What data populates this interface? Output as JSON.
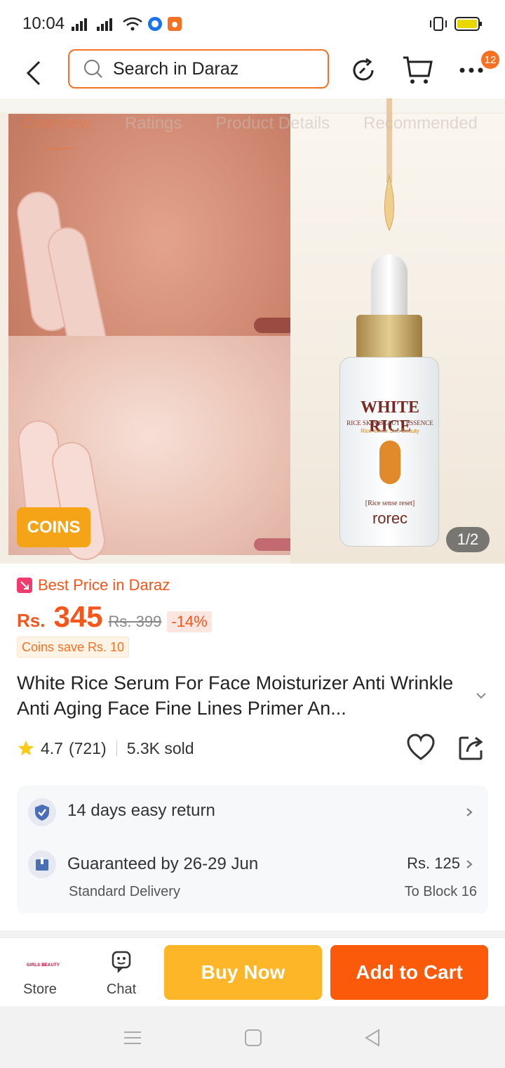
{
  "status_bar": {
    "time": "10:04"
  },
  "header": {
    "search_placeholder": "Search in Daraz",
    "cart_badge": "12"
  },
  "gallery": {
    "tabs": [
      "Overview",
      "Ratings",
      "Product Details",
      "Recommended"
    ],
    "coins_badge": "COINS",
    "page_counter": "1/2",
    "bottle_label": {
      "title": "WHITE RICE",
      "sub": "RICE SKIN BEAUTY ESSENCE",
      "sub2": "Rice White Skin Beauty",
      "small": "[Rice sense reset]",
      "brand": "rorec"
    }
  },
  "product": {
    "best_price": "Best Price in Daraz",
    "currency": "Rs.",
    "price": "345",
    "old_price": "Rs. 399",
    "discount": "-14%",
    "coins_save": "Coins save Rs. 10",
    "title": "White Rice Serum For Face Moisturizer Anti Wrinkle Anti Aging Face Fine Lines Primer An...",
    "rating": "4.7",
    "rating_count": "(721)",
    "sold": "5.3K sold"
  },
  "services": {
    "return_text": "14 days easy return",
    "delivery_text": "Guaranteed by 26-29 Jun",
    "delivery_sub": "Standard Delivery",
    "delivery_price": "Rs. 125",
    "delivery_dest": "To Block 16"
  },
  "bottom_bar": {
    "store_logo": "GIRLS BEAUTY",
    "store_label": "Store",
    "chat_label": "Chat",
    "buy_now": "Buy Now",
    "add_to_cart": "Add to Cart"
  },
  "colors": {
    "accent": "#f57224",
    "buy_now": "#fdb627",
    "add_to_cart": "#fc5a0b"
  }
}
